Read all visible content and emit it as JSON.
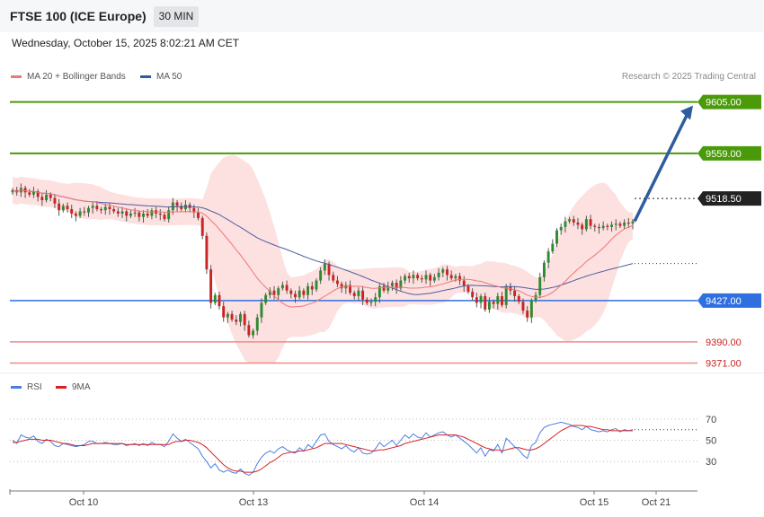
{
  "header": {
    "title": "FTSE 100 (ICE Europe)",
    "timeframe": "30 MIN",
    "datetime": "Wednesday, October 15, 2025 8:02:21 AM CET"
  },
  "legend": {
    "ma20": "MA 20 + Bollinger Bands",
    "ma50": "MA 50",
    "credit": "Research © 2025 Trading Central"
  },
  "rsi_legend": {
    "rsi": "RSI",
    "ma9": "9MA"
  },
  "colors": {
    "bull": "#2e8b2e",
    "bear": "#cc2222",
    "resistance": "#4a9a0a",
    "support_blue": "#2f6fe0",
    "support_red": "#f08a8a",
    "last_price": "#222222",
    "ma50": "#4b5fa0",
    "ma20": "#ee7777",
    "bands": "#fde0e0",
    "arrow": "#2e5c9e"
  },
  "chart_data": [
    {
      "type": "line",
      "subtype": "candlestick",
      "interval": "30 MIN",
      "x_ticks": [
        "Oct 10",
        "Oct 13",
        "Oct 14",
        "Oct 15",
        "Oct 21"
      ],
      "ylim": [
        9365,
        9620
      ],
      "close": [
        9526,
        9524,
        9528,
        9524,
        9522,
        9525,
        9520,
        9517,
        9522,
        9519,
        9514,
        9508,
        9512,
        9509,
        9505,
        9503,
        9507,
        9506,
        9510,
        9512,
        9509,
        9508,
        9511,
        9509,
        9507,
        9505,
        9507,
        9503,
        9505,
        9506,
        9502,
        9505,
        9503,
        9508,
        9505,
        9504,
        9500,
        9508,
        9515,
        9512,
        9509,
        9513,
        9510,
        9506,
        9501,
        9485,
        9455,
        9425,
        9432,
        9422,
        9412,
        9415,
        9410,
        9408,
        9415,
        9405,
        9396,
        9400,
        9412,
        9425,
        9432,
        9436,
        9432,
        9438,
        9441,
        9436,
        9433,
        9430,
        9436,
        9432,
        9440,
        9437,
        9445,
        9454,
        9460,
        9450,
        9445,
        9442,
        9438,
        9441,
        9434,
        9431,
        9436,
        9428,
        9425,
        9426,
        9430,
        9440,
        9436,
        9440,
        9443,
        9438,
        9445,
        9449,
        9447,
        9450,
        9447,
        9446,
        9450,
        9445,
        9448,
        9452,
        9455,
        9450,
        9447,
        9449,
        9445,
        9440,
        9435,
        9430,
        9425,
        9431,
        9419,
        9426,
        9424,
        9431,
        9423,
        9440,
        9436,
        9431,
        9426,
        9418,
        9412,
        9427,
        9432,
        9448,
        9461,
        9471,
        9478,
        9490,
        9493,
        9498,
        9500,
        9497,
        9495,
        9491,
        9500,
        9494,
        9493,
        9492,
        9494,
        9493,
        9495,
        9496,
        9494,
        9497,
        9496,
        9498
      ],
      "bollinger_upper_max": 9605,
      "bollinger_lower_min": 9371,
      "levels": [
        {
          "value": 9605.0,
          "label": "9605.00",
          "kind": "resistance"
        },
        {
          "value": 9559.0,
          "label": "9559.00",
          "kind": "resistance"
        },
        {
          "value": 9518.5,
          "label": "9518.50",
          "kind": "last"
        },
        {
          "value": 9427.0,
          "label": "9427.00",
          "kind": "support"
        },
        {
          "value": 9390.0,
          "label": "9390.00",
          "kind": "support2"
        },
        {
          "value": 9371.0,
          "label": "9371.00",
          "kind": "support2"
        }
      ],
      "projection_target": 9605,
      "legend": [
        "MA 20 + Bollinger Bands",
        "MA 50"
      ]
    },
    {
      "type": "line",
      "title": "",
      "series": [
        {
          "name": "RSI"
        },
        {
          "name": "9MA"
        }
      ],
      "yticks": [
        70,
        50,
        30
      ],
      "ylim": [
        15,
        80
      ],
      "rsi_values": [
        50,
        47,
        55,
        53,
        52,
        54,
        49,
        47,
        51,
        49,
        45,
        44,
        47,
        46,
        45,
        44,
        45,
        46,
        49,
        49,
        47,
        47,
        48,
        47,
        46,
        46,
        47,
        45,
        46,
        47,
        45,
        47,
        45,
        48,
        46,
        46,
        44,
        49,
        56,
        52,
        49,
        51,
        48,
        45,
        42,
        35,
        30,
        24,
        28,
        22,
        20,
        22,
        20,
        19,
        23,
        19,
        17,
        20,
        28,
        34,
        38,
        40,
        38,
        42,
        44,
        41,
        39,
        38,
        43,
        40,
        46,
        43,
        49,
        55,
        56,
        49,
        46,
        44,
        42,
        45,
        41,
        39,
        43,
        38,
        37,
        38,
        42,
        48,
        44,
        47,
        50,
        45,
        50,
        55,
        52,
        56,
        53,
        52,
        57,
        53,
        55,
        57,
        58,
        55,
        53,
        55,
        52,
        49,
        46,
        42,
        38,
        43,
        35,
        41,
        40,
        46,
        38,
        52,
        48,
        44,
        41,
        36,
        33,
        45,
        48,
        57,
        62,
        64,
        65,
        66,
        67,
        66,
        65,
        63,
        62,
        60,
        63,
        60,
        59,
        58,
        59,
        58,
        60,
        61,
        58,
        60,
        59,
        60
      ],
      "ma9_values": [
        48,
        48,
        49,
        50,
        51,
        51,
        51,
        50,
        50,
        50,
        49,
        48,
        47,
        47,
        46,
        45,
        45,
        45,
        46,
        47,
        47,
        47,
        47,
        47,
        47,
        47,
        47,
        46,
        46,
        46,
        46,
        46,
        46,
        46,
        46,
        46,
        46,
        46,
        48,
        49,
        49,
        50,
        50,
        49,
        48,
        46,
        43,
        39,
        35,
        31,
        27,
        24,
        22,
        21,
        21,
        20,
        20,
        20,
        21,
        23,
        26,
        29,
        31,
        34,
        37,
        38,
        39,
        39,
        40,
        40,
        41,
        42,
        43,
        45,
        47,
        47,
        47,
        47,
        47,
        46,
        45,
        44,
        43,
        42,
        41,
        40,
        40,
        41,
        41,
        42,
        43,
        44,
        45,
        47,
        48,
        49,
        50,
        51,
        52,
        53,
        54,
        55,
        55,
        55,
        55,
        55,
        54,
        53,
        51,
        49,
        47,
        45,
        43,
        42,
        41,
        41,
        40,
        41,
        42,
        43,
        43,
        42,
        41,
        41,
        42,
        44,
        47,
        50,
        53,
        56,
        59,
        61,
        63,
        64,
        64,
        64,
        63,
        63,
        62,
        61,
        60,
        60,
        59,
        59,
        59,
        59,
        59,
        59
      ],
      "x_ticks": [
        "Oct 10",
        "Oct 13",
        "Oct 14",
        "Oct 15",
        "Oct 21"
      ]
    }
  ]
}
